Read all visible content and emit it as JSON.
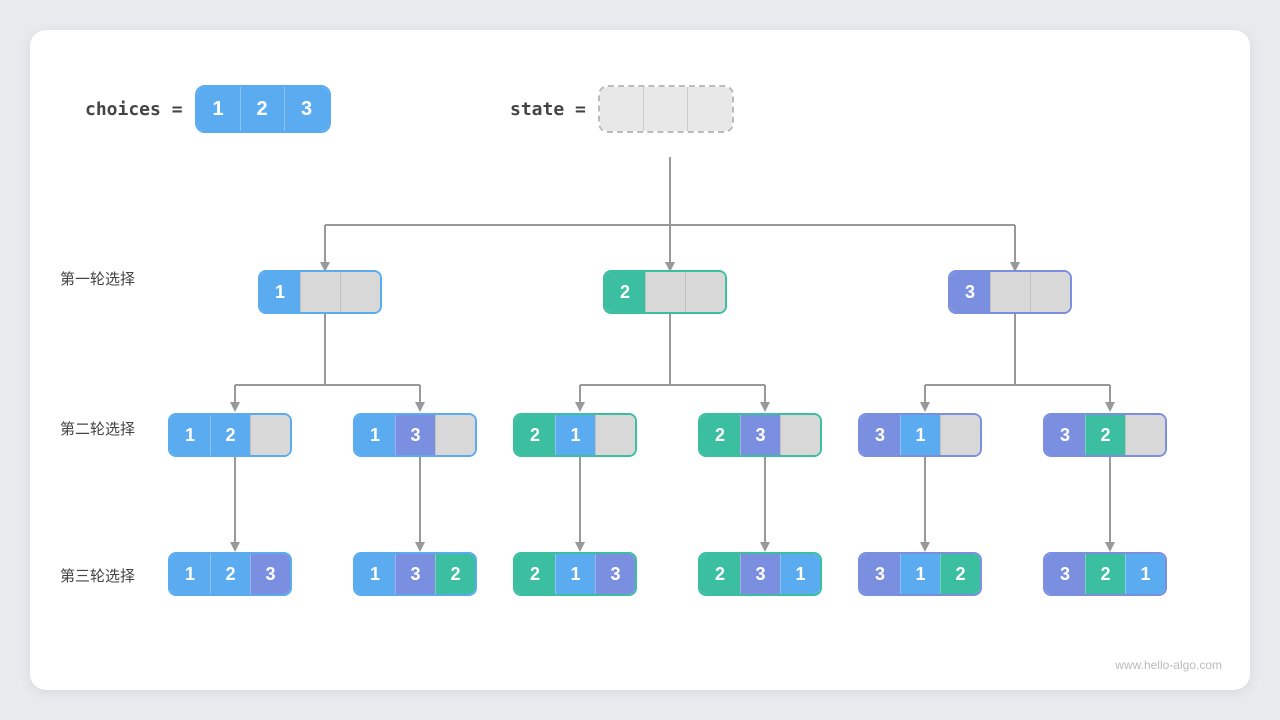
{
  "watermark": "www.hello-algo.com",
  "header": {
    "choices_label": "choices =",
    "state_label": "state ="
  },
  "row_labels": {
    "round1": "第一轮选择",
    "round2": "第二轮选择",
    "round3": "第三轮选择"
  },
  "choices": [
    1,
    2,
    3
  ],
  "level1_nodes": [
    {
      "first": 1,
      "color": "blue",
      "label": "1"
    },
    {
      "first": 2,
      "color": "teal",
      "label": "2"
    },
    {
      "first": 3,
      "color": "purple",
      "label": "3"
    }
  ],
  "level2_nodes": [
    {
      "vals": [
        1,
        2
      ],
      "colors": [
        "blue",
        "blue"
      ],
      "label": "1,2"
    },
    {
      "vals": [
        1,
        3
      ],
      "colors": [
        "blue",
        "purple"
      ],
      "label": "1,3"
    },
    {
      "vals": [
        2,
        1
      ],
      "colors": [
        "teal",
        "blue"
      ],
      "label": "2,1"
    },
    {
      "vals": [
        2,
        3
      ],
      "colors": [
        "teal",
        "purple"
      ],
      "label": "2,3"
    },
    {
      "vals": [
        3,
        1
      ],
      "colors": [
        "purple",
        "blue"
      ],
      "label": "3,1"
    },
    {
      "vals": [
        3,
        2
      ],
      "colors": [
        "purple",
        "teal"
      ],
      "label": "3,2"
    }
  ],
  "level3_nodes": [
    {
      "vals": [
        1,
        2,
        3
      ],
      "colors": [
        "blue",
        "blue",
        "purple"
      ]
    },
    {
      "vals": [
        1,
        3,
        2
      ],
      "colors": [
        "blue",
        "purple",
        "teal"
      ]
    },
    {
      "vals": [
        2,
        1,
        3
      ],
      "colors": [
        "teal",
        "blue",
        "purple"
      ]
    },
    {
      "vals": [
        2,
        3,
        1
      ],
      "colors": [
        "teal",
        "purple",
        "blue"
      ]
    },
    {
      "vals": [
        3,
        1,
        2
      ],
      "colors": [
        "purple",
        "blue",
        "teal"
      ]
    },
    {
      "vals": [
        3,
        2,
        1
      ],
      "colors": [
        "purple",
        "teal",
        "blue"
      ]
    }
  ]
}
